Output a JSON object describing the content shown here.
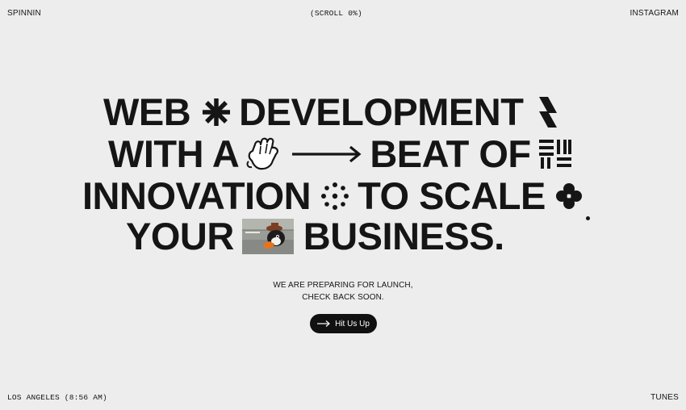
{
  "header": {
    "logo": "SPINNIN",
    "scroll_indicator": "(SCROLL 0%)",
    "instagram_link": "INSTAGRAM"
  },
  "hero": {
    "line1": [
      "WEB",
      "DEVELOPMENT"
    ],
    "line2": [
      "WITH A",
      "BEAT OF"
    ],
    "line3": [
      "INNOVATION",
      "TO SCALE"
    ],
    "line4": [
      "YOUR",
      "BUSINESS."
    ],
    "icons": [
      "asterisk-icon",
      "lightning-bolt-icon",
      "cartoon-glove-icon",
      "long-arrow-right-icon",
      "stripes-grid-icon",
      "dot-circle-icon",
      "clover-icon",
      "duck-image"
    ]
  },
  "tagline": {
    "line1": "WE ARE PREPARING FOR LAUNCH,",
    "line2": "CHECK BACK SOON."
  },
  "cta": {
    "label": "Hit Us Up"
  },
  "footer": {
    "location": "LOS ANGELES (8:56 AM)",
    "tunes_link": "TUNES"
  },
  "colors": {
    "background": "#ededed",
    "text": "#151515",
    "button_bg": "#111111",
    "button_text": "#ffffff"
  }
}
